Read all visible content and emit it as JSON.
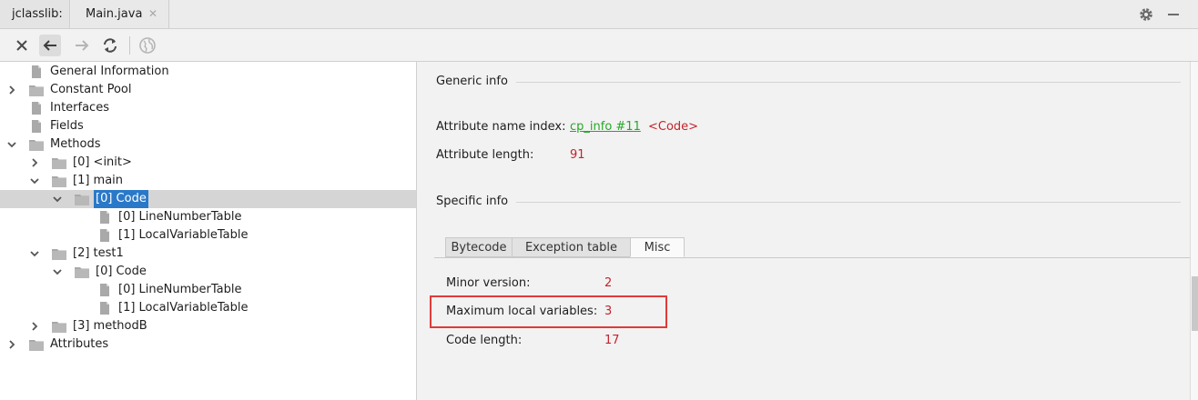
{
  "tabs": [
    {
      "label": "jclasslib:"
    },
    {
      "label": "Main.java",
      "close": "✕"
    }
  ],
  "tree": {
    "items": [
      {
        "label": "General Information",
        "depth": 0,
        "arrow": "none",
        "icon": "file"
      },
      {
        "label": "Constant Pool",
        "depth": 0,
        "arrow": "right",
        "icon": "folder"
      },
      {
        "label": "Interfaces",
        "depth": 0,
        "arrow": "none",
        "icon": "file"
      },
      {
        "label": "Fields",
        "depth": 0,
        "arrow": "none",
        "icon": "file"
      },
      {
        "label": "Methods",
        "depth": 0,
        "arrow": "down",
        "icon": "folder"
      },
      {
        "label": "[0] <init>",
        "depth": 1,
        "arrow": "right",
        "icon": "folder"
      },
      {
        "label": "[1] main",
        "depth": 1,
        "arrow": "down",
        "icon": "folder"
      },
      {
        "label": "[0] Code",
        "depth": 2,
        "arrow": "down",
        "icon": "folder",
        "selected": true
      },
      {
        "label": "[0] LineNumberTable",
        "depth": 3,
        "arrow": "none",
        "icon": "file"
      },
      {
        "label": "[1] LocalVariableTable",
        "depth": 3,
        "arrow": "none",
        "icon": "file"
      },
      {
        "label": "[2] test1",
        "depth": 1,
        "arrow": "down",
        "icon": "folder"
      },
      {
        "label": "[0] Code",
        "depth": 2,
        "arrow": "down",
        "icon": "folder"
      },
      {
        "label": "[0] LineNumberTable",
        "depth": 3,
        "arrow": "none",
        "icon": "file"
      },
      {
        "label": "[1] LocalVariableTable",
        "depth": 3,
        "arrow": "none",
        "icon": "file"
      },
      {
        "label": "[3] methodB",
        "depth": 1,
        "arrow": "right",
        "icon": "folder"
      },
      {
        "label": "Attributes",
        "depth": 0,
        "arrow": "right",
        "icon": "folder"
      }
    ]
  },
  "generic": {
    "title": "Generic info",
    "name_index_label": "Attribute name index:",
    "name_index_link": "cp_info #11",
    "name_index_value": "<Code>",
    "length_label": "Attribute length:",
    "length_value": "91"
  },
  "specific": {
    "title": "Specific info",
    "tabs": [
      "Bytecode",
      "Exception table",
      "Misc"
    ],
    "active_tab": "Misc",
    "minor_label": "Minor version:",
    "minor_value": "2",
    "maxlocals_label": "Maximum local variables:",
    "maxlocals_value": "3",
    "codelen_label": "Code length:",
    "codelen_value": "17"
  },
  "colors": {
    "link": "#27a827",
    "value_red": "#c4242b",
    "highlight_box": "#e03a3a",
    "selection": "#2a79c9"
  }
}
